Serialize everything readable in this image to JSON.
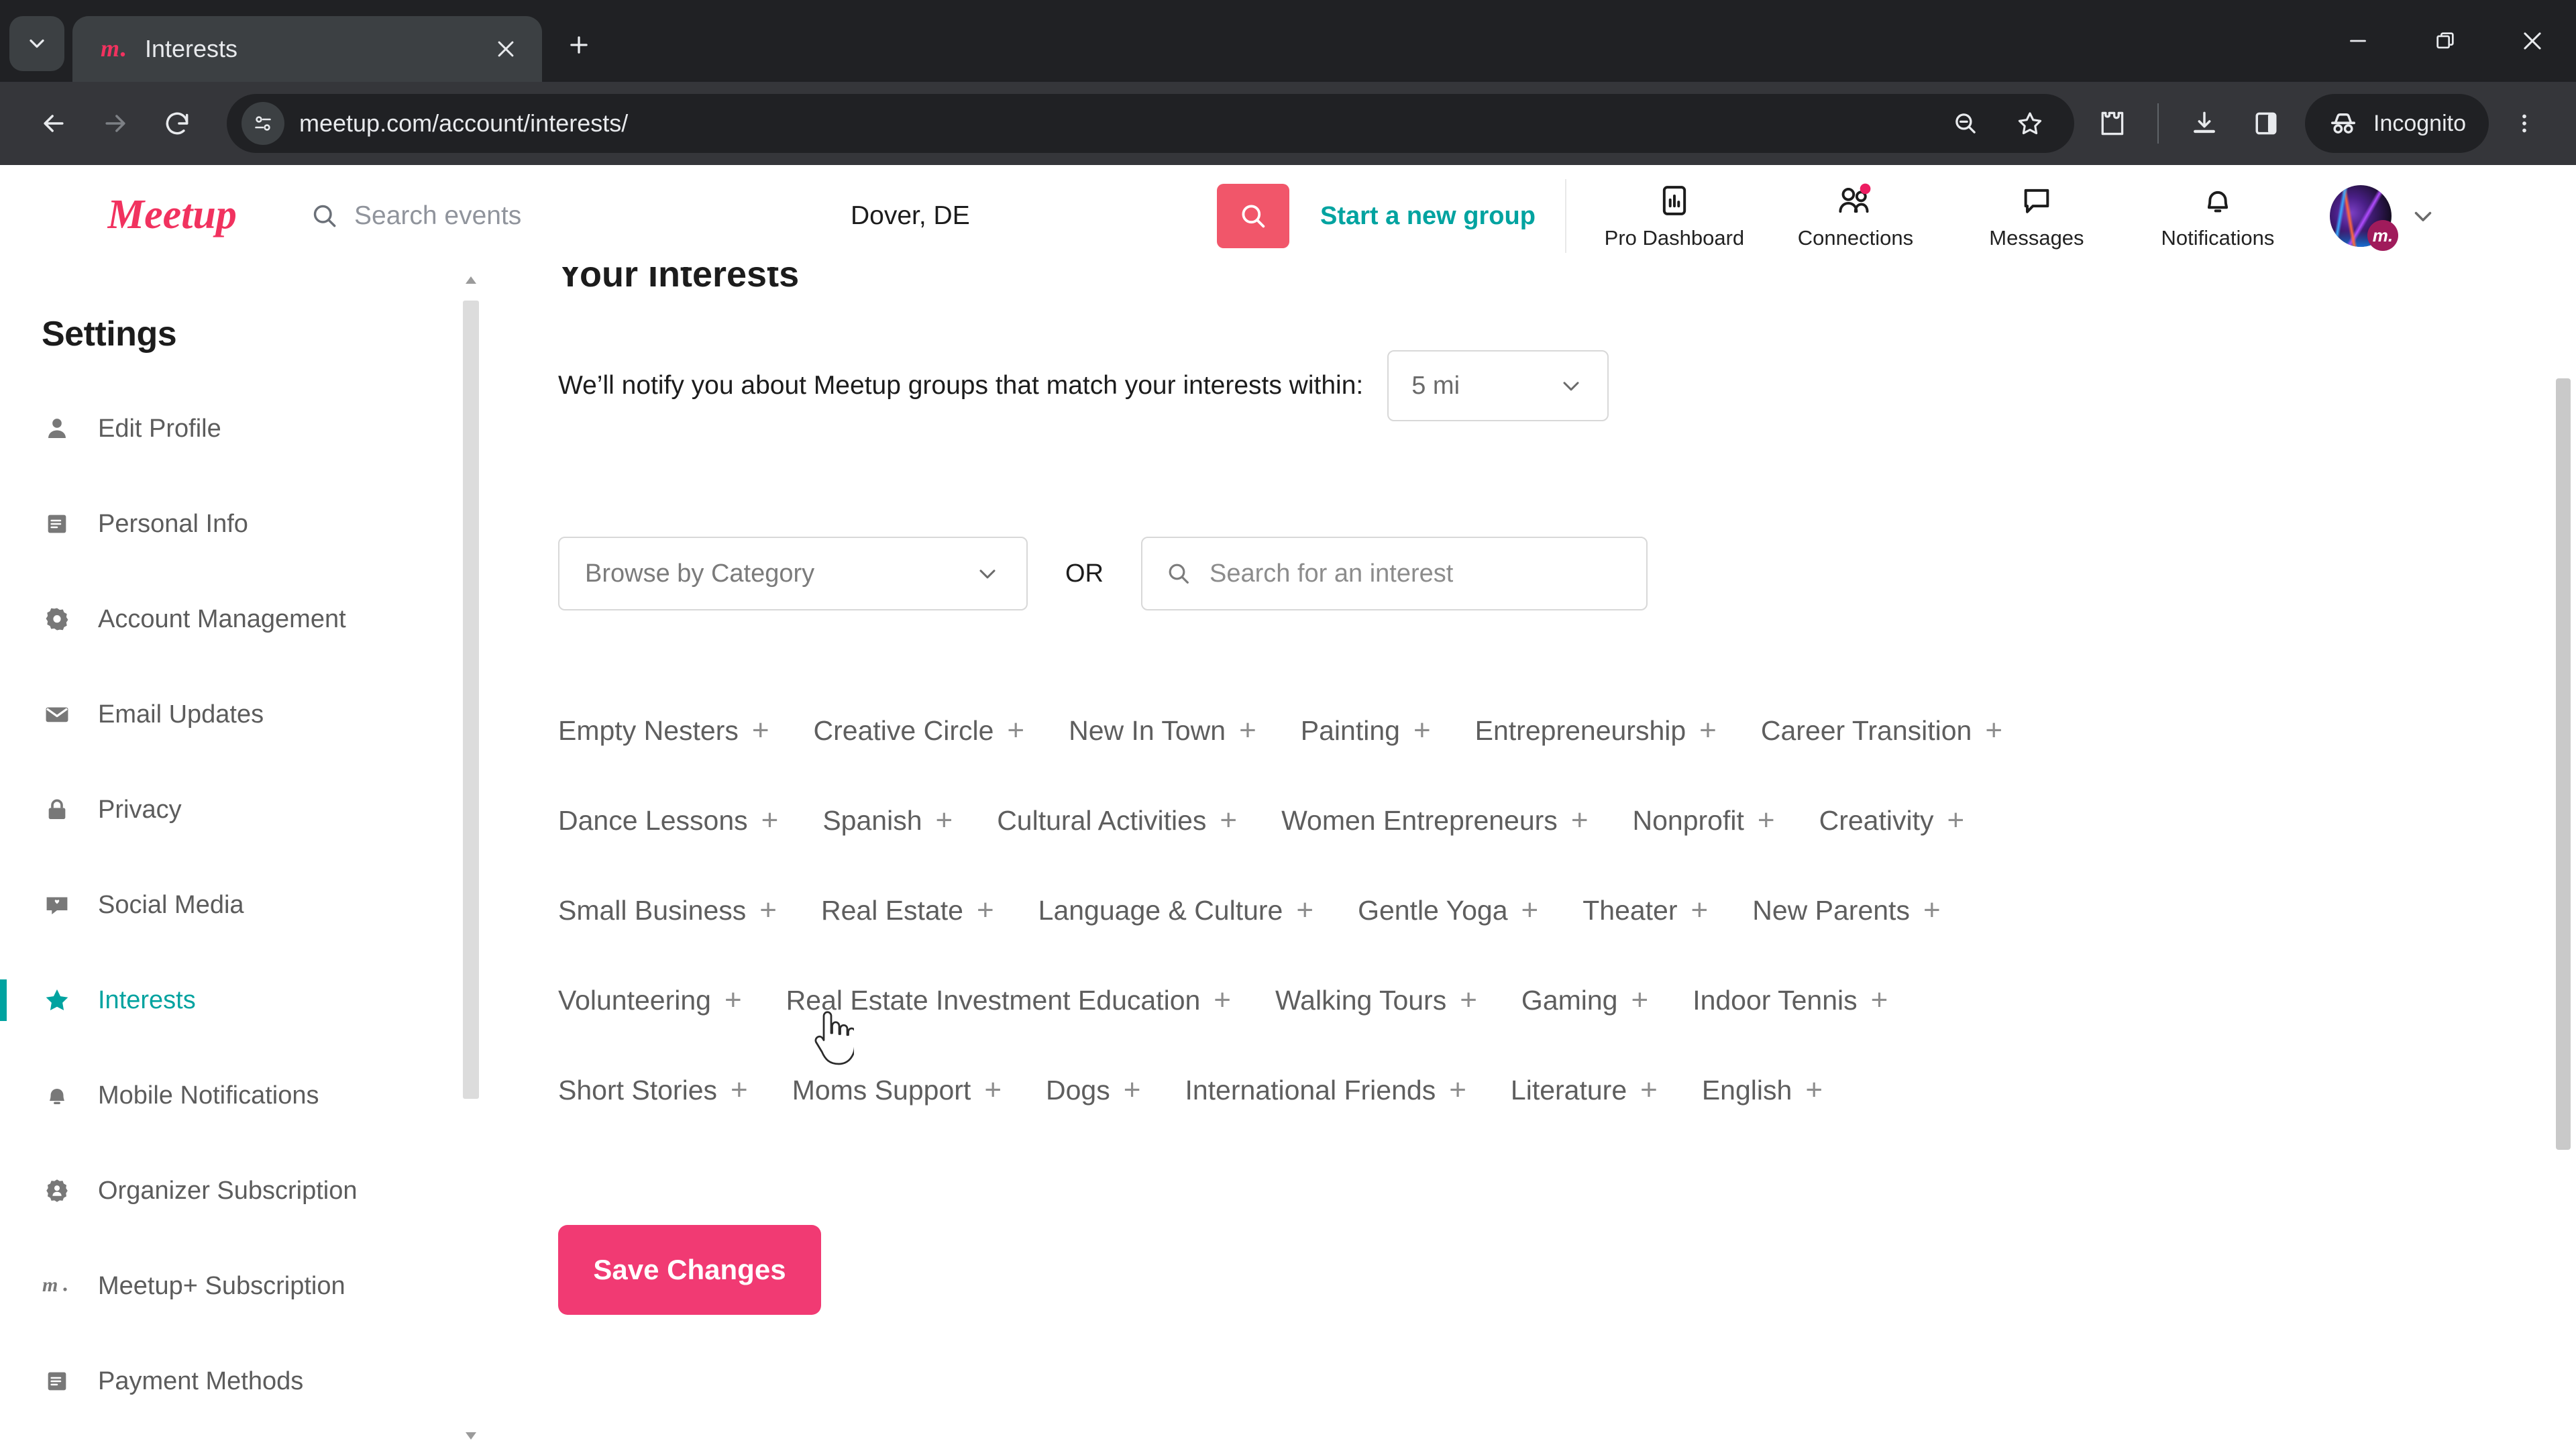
{
  "browser": {
    "tab": {
      "title": "Interests",
      "favicon": "meetup-favicon",
      "close": "close-icon"
    },
    "tablist_icon": "chevron-down-icon",
    "newtab_icon": "plus-icon",
    "window_controls": {
      "minimize": "minimize-icon",
      "maximize": "maximize-icon",
      "close": "close-icon"
    },
    "nav": {
      "back": "back-arrow-icon",
      "forward": "forward-arrow-icon",
      "reload": "reload-icon"
    },
    "omnibox": {
      "site_settings_icon": "page-settings-icon",
      "url": "meetup.com/account/interests/",
      "zoom_out_icon": "zoom-out-icon",
      "bookmark_icon": "star-icon"
    },
    "extensions_icon": "extensions-puzzle-icon",
    "downloads_icon": "download-icon",
    "side_panel_icon": "side-panel-icon",
    "incognito": {
      "label": "Incognito",
      "icon": "incognito-hat-icon"
    },
    "menu_icon": "three-dot-menu-icon"
  },
  "site_header": {
    "logo": "meetup-logo",
    "search": {
      "icon": "search-icon",
      "placeholder": "Search events"
    },
    "location": {
      "value": "Dover, DE"
    },
    "search_button": {
      "icon": "search-icon"
    },
    "start_group_link": "Start a new group",
    "nav_items": [
      {
        "label": "Pro Dashboard",
        "icon": "chart-bar-icon",
        "badge": false
      },
      {
        "label": "Connections",
        "icon": "people-icon",
        "badge": true
      },
      {
        "label": "Messages",
        "icon": "chat-bubble-icon",
        "badge": false
      },
      {
        "label": "Notifications",
        "icon": "bell-icon",
        "badge": false
      }
    ],
    "avatar": {
      "name": "avatar",
      "badge": "m."
    },
    "avatar_caret": "chevron-down-icon"
  },
  "sidebar": {
    "title": "Settings",
    "items": [
      {
        "label": "Edit Profile",
        "icon": "person-icon",
        "active": false
      },
      {
        "label": "Personal Info",
        "icon": "document-icon",
        "active": false
      },
      {
        "label": "Account Management",
        "icon": "gear-icon",
        "active": false
      },
      {
        "label": "Email Updates",
        "icon": "envelope-icon",
        "active": false
      },
      {
        "label": "Privacy",
        "icon": "lock-icon",
        "active": false
      },
      {
        "label": "Social Media",
        "icon": "social-chat-icon",
        "active": false
      },
      {
        "label": "Interests",
        "icon": "star-icon",
        "active": true
      },
      {
        "label": "Mobile Notifications",
        "icon": "bell-icon",
        "active": false
      },
      {
        "label": "Organizer Subscription",
        "icon": "organizer-badge-icon",
        "active": false
      },
      {
        "label": "Meetup+ Subscription",
        "icon": "meetup-plus-icon",
        "active": false
      },
      {
        "label": "Payment Methods",
        "icon": "card-icon",
        "active": false
      }
    ],
    "scroll_up_icon": "scroll-up-arrow-icon",
    "scroll_down_icon": "scroll-down-arrow-icon"
  },
  "main": {
    "title": "Your Interests",
    "notify_text": "We’ll notify you about Meetup groups that match your interests within:",
    "distance_select": {
      "value": "5 mi",
      "caret": "chevron-down-icon"
    },
    "category_select": {
      "value": "Browse by Category",
      "caret": "chevron-down-icon"
    },
    "or_label": "OR",
    "interest_search": {
      "icon": "search-icon",
      "placeholder": "Search for an interest"
    },
    "tag_rows": [
      [
        {
          "label": "Empty Nesters",
          "add": "+"
        },
        {
          "label": "Creative Circle",
          "add": "+"
        },
        {
          "label": "New In Town",
          "add": "+"
        },
        {
          "label": "Painting",
          "add": "+"
        },
        {
          "label": "Entrepreneurship",
          "add": "+"
        },
        {
          "label": "Career Transition",
          "add": "+"
        }
      ],
      [
        {
          "label": "Dance Lessons",
          "add": "+"
        },
        {
          "label": "Spanish",
          "add": "+"
        },
        {
          "label": "Cultural Activities",
          "add": "+"
        },
        {
          "label": "Women Entrepreneurs",
          "add": "+"
        },
        {
          "label": "Nonprofit",
          "add": "+"
        },
        {
          "label": "Creativity",
          "add": "+"
        }
      ],
      [
        {
          "label": "Small Business",
          "add": "+"
        },
        {
          "label": "Real Estate",
          "add": "+"
        },
        {
          "label": "Language & Culture",
          "add": "+"
        },
        {
          "label": "Gentle Yoga",
          "add": "+"
        },
        {
          "label": "Theater",
          "add": "+"
        },
        {
          "label": "New Parents",
          "add": "+"
        }
      ],
      [
        {
          "label": "Volunteering",
          "add": "+"
        },
        {
          "label": "Real Estate Investment Education",
          "add": "+"
        },
        {
          "label": "Walking Tours",
          "add": "+"
        },
        {
          "label": "Gaming",
          "add": "+"
        },
        {
          "label": "Indoor Tennis",
          "add": "+"
        }
      ],
      [
        {
          "label": "Short Stories",
          "add": "+"
        },
        {
          "label": "Moms Support",
          "add": "+"
        },
        {
          "label": "Dogs",
          "add": "+"
        },
        {
          "label": "International Friends",
          "add": "+"
        },
        {
          "label": "Literature",
          "add": "+"
        },
        {
          "label": "English",
          "add": "+"
        }
      ]
    ],
    "save_button": "Save Changes"
  },
  "colors": {
    "brand_red": "#f1566a",
    "brand_pink": "#f13a73",
    "teal": "#00a3a0",
    "chrome_dark": "#202124",
    "chrome_toolbar": "#35363a"
  }
}
